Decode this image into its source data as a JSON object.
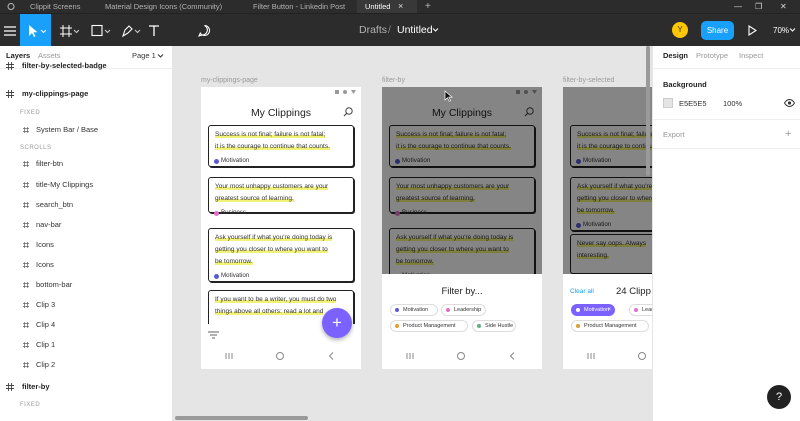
{
  "tabs": [
    {
      "label": "Clippit Screens",
      "active": false
    },
    {
      "label": "Material Design Icons (Community)",
      "active": false
    },
    {
      "label": "Filter Button - Linkedin Post",
      "active": false
    },
    {
      "label": "Untitled",
      "active": true
    }
  ],
  "tab_add": "+",
  "tab_close": "×",
  "toolbar": {
    "breadcrumb_root": "Drafts",
    "breadcrumb_sep": "/",
    "file_name": "Untitled",
    "avatar_initial": "Y",
    "share_label": "Share",
    "zoom": "70%"
  },
  "left_panel": {
    "tab_layers": "Layers",
    "tab_assets": "Assets",
    "page_selector": "Page 1",
    "layers": [
      {
        "label": "filter-by-selected-badge",
        "kind": "frame"
      },
      {
        "label": "my-clippings-page",
        "kind": "frame"
      },
      {
        "label": "FIXED",
        "kind": "section"
      },
      {
        "label": "System Bar / Base",
        "kind": "component"
      },
      {
        "label": "SCROLLS",
        "kind": "section"
      },
      {
        "label": "filter-btn",
        "kind": "group"
      },
      {
        "label": "title-My Clippings",
        "kind": "group"
      },
      {
        "label": "search_btn",
        "kind": "group"
      },
      {
        "label": "nav-bar",
        "kind": "group"
      },
      {
        "label": "Icons",
        "kind": "group"
      },
      {
        "label": "Icons",
        "kind": "group"
      },
      {
        "label": "bottom-bar",
        "kind": "group"
      },
      {
        "label": "Clip 3",
        "kind": "group"
      },
      {
        "label": "Clip 4",
        "kind": "group"
      },
      {
        "label": "Clip 1",
        "kind": "group"
      },
      {
        "label": "Clip 2",
        "kind": "group"
      },
      {
        "label": "filter-by",
        "kind": "frame"
      },
      {
        "label": "FIXED",
        "kind": "section"
      }
    ]
  },
  "canvas": {
    "frame_labels": [
      "my-clippings-page",
      "filter-by",
      "filter-by-selected"
    ],
    "page_title": "My Clippings",
    "clips": [
      {
        "lines": [
          "Success is not final; failure is not fatal;",
          "it is the courage to continue that counts."
        ],
        "tag": "Motivation",
        "tag_color": "#5b5bd6"
      },
      {
        "lines": [
          "Your most unhappy customers are your",
          "greatest source of learning."
        ],
        "tag": "Business",
        "tag_color": "#e070c8"
      },
      {
        "lines": [
          "Ask yourself if what you're doing today is",
          "getting you closer to where you want to",
          "be tomorrow."
        ],
        "tag": "Motivation",
        "tag_color": "#5b5bd6"
      },
      {
        "lines": [
          "If you want to be a writer, you must do two",
          "things above all others: read a lot and"
        ],
        "tag": "",
        "tag_color": ""
      }
    ],
    "selected_clips": [
      {
        "lines": [
          "Success is not final; failure is not fatal;",
          "it is the courage to continue that counts."
        ],
        "tag": "Motivation"
      },
      {
        "lines": [
          "Ask yourself if what you're doing today is",
          "getting you closer to where you want to",
          "be tomorrow."
        ],
        "tag": "Motivation"
      },
      {
        "lines": [
          "Never say oops. Always",
          "interesting."
        ],
        "tag": ""
      }
    ],
    "filter_sheet": {
      "title": "Filter by...",
      "chips": [
        {
          "label": "Motivation",
          "color": "#5b5bd6"
        },
        {
          "label": "Leadership",
          "color": "#e070c8"
        },
        {
          "label": "Product Management",
          "color": "#e0a030"
        },
        {
          "label": "Side Hustle",
          "color": "#60b080"
        }
      ]
    },
    "selected_sheet": {
      "clear_label": "Clear all",
      "count_label": "24 Clipp",
      "chips": [
        {
          "label": "Motivation",
          "color": "#5b5bd6",
          "selected": true
        },
        {
          "label": "Leader",
          "color": "#e070c8",
          "selected": false
        },
        {
          "label": "Product Management",
          "color": "#e0a030",
          "selected": false
        }
      ]
    },
    "fab_label": "+"
  },
  "right_panel": {
    "tab_design": "Design",
    "tab_prototype": "Prototype",
    "tab_inspect": "Inspect",
    "background_label": "Background",
    "background_hex": "E5E5E5",
    "background_opacity": "100%",
    "export_label": "Export",
    "help_label": "?"
  },
  "colors": {
    "accent": "#18a0fb",
    "avatar": "#ffc700",
    "fab": "#7b61ff",
    "highlight": "#f2f27a"
  }
}
